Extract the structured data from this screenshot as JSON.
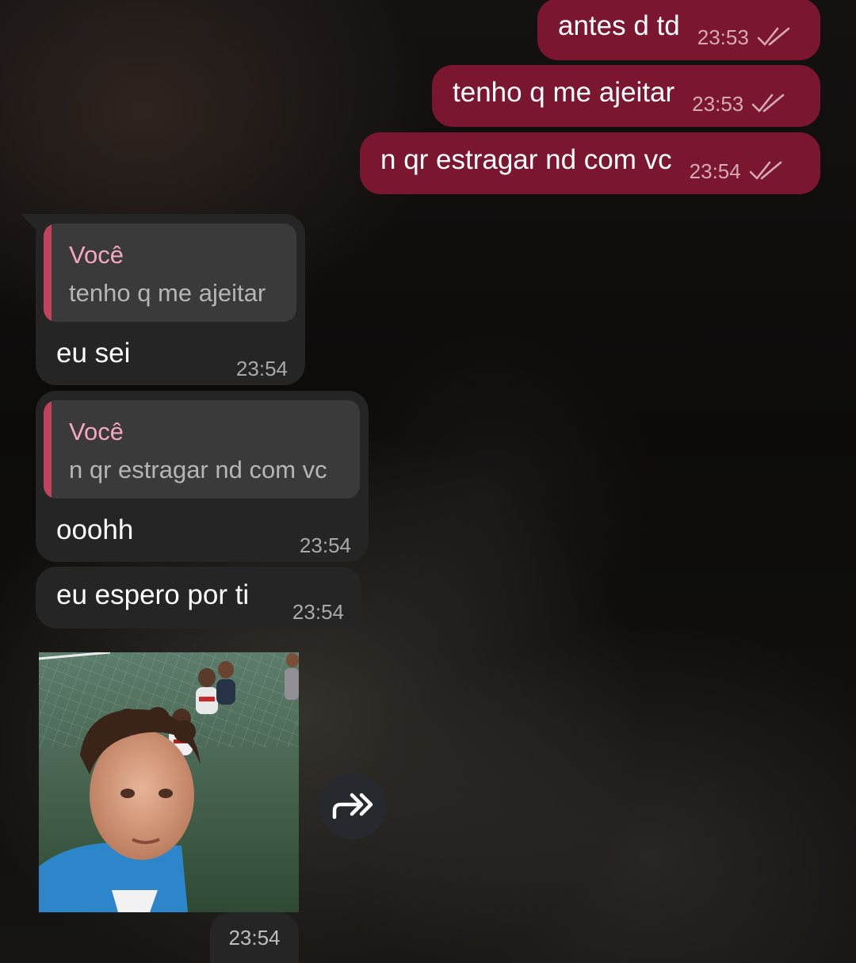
{
  "outgoing_messages": [
    {
      "text": "antes d td",
      "time": "23:53"
    },
    {
      "text": "tenho q me ajeitar",
      "time": "23:53"
    },
    {
      "text": "n qr estragar nd com vc",
      "time": "23:54"
    }
  ],
  "incoming_messages": [
    {
      "reply_author": "Você",
      "reply_text": "tenho q me ajeitar",
      "text": "eu sei",
      "time": "23:54"
    },
    {
      "reply_author": "Você",
      "reply_text": "n qr estragar nd com vc",
      "text": "ooohh",
      "time": "23:54"
    },
    {
      "text": "eu espero por ti",
      "time": "23:54"
    }
  ],
  "photo_message": {
    "time": "23:54",
    "forward_icon": "forward-icon"
  },
  "colors": {
    "outgoing_bubble": "#7b1630",
    "incoming_bubble": "#252525",
    "quote_bar": "#c2415e",
    "quote_author": "#f4a7c2"
  }
}
